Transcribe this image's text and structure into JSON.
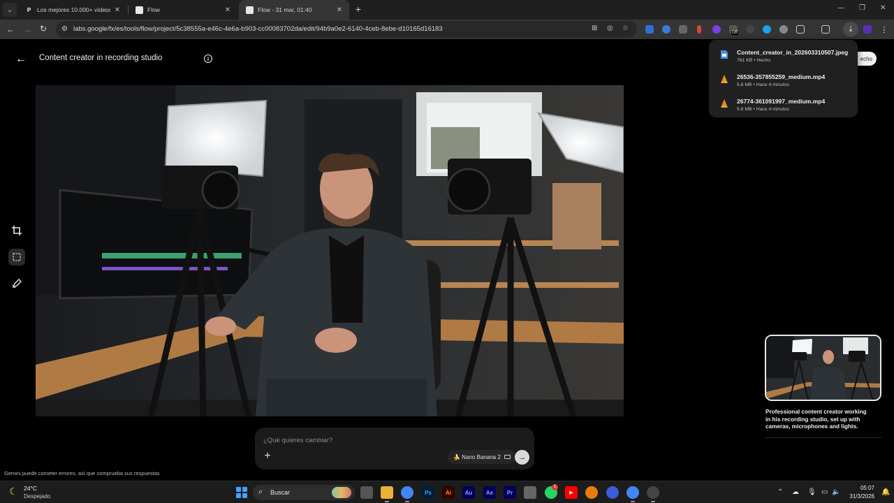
{
  "browser": {
    "tabs": [
      {
        "title": "Los mejores 10.000+ vídeos de",
        "favicon": "pexels-icon",
        "active": false
      },
      {
        "title": "Flow",
        "favicon": "page-icon",
        "active": false
      },
      {
        "title": "Flow - 31 mar, 01:40",
        "favicon": "page-icon",
        "active": true
      }
    ],
    "url": "labs.google/fx/es/tools/flow/project/5c38555a-e46c-4e6a-b903-cc00083702da/edit/94b9a0e2-6140-4ceb-8ebe-d10165d16183",
    "ext_badge": "Off"
  },
  "downloads": {
    "items": [
      {
        "name": "Content_creator_in_202603310507.jpeg",
        "meta": "761 KB • Hecho",
        "type": "image"
      },
      {
        "name": "26536-357855259_medium.mp4",
        "meta": "5,6 MB • Hace 4 minutos",
        "type": "video"
      },
      {
        "name": "26774-361091997_medium.mp4",
        "meta": "5,6 MB • Hace 4 minutos",
        "type": "video"
      }
    ],
    "behind_chip": "echo"
  },
  "app": {
    "title": "Content creator in recording studio",
    "thumbnail_caption": "Professional content creator working in his recording studio, set up with cameras, microphones and lights.",
    "prompt": {
      "placeholder": "¿Qué quieres cambiar?",
      "model_label": "🍌 Nano Banana 2"
    },
    "disclaimer": "Gemini puede cometer errores, así que comprueba sus respuestas"
  },
  "taskbar": {
    "weather_temp": "24°C",
    "weather_desc": "Despejado",
    "search_label": "Buscar",
    "apps": [
      {
        "name": "task-view",
        "label": "",
        "color": "#555555"
      },
      {
        "name": "file-explorer",
        "label": "",
        "color": "#e8b335"
      },
      {
        "name": "chrome",
        "label": "",
        "color": "#4285f4"
      },
      {
        "name": "photoshop",
        "label": "Ps",
        "color": "#001e36"
      },
      {
        "name": "illustrator",
        "label": "Ai",
        "color": "#330000"
      },
      {
        "name": "audition",
        "label": "Au",
        "color": "#00005b"
      },
      {
        "name": "after-effects",
        "label": "Ae",
        "color": "#00005b"
      },
      {
        "name": "premiere",
        "label": "Pr",
        "color": "#00005b"
      },
      {
        "name": "app-generic",
        "label": "",
        "color": "#666666"
      },
      {
        "name": "whatsapp",
        "label": "",
        "color": "#25d366"
      },
      {
        "name": "youtube",
        "label": "▶",
        "color": "#ff0000"
      },
      {
        "name": "blender",
        "label": "",
        "color": "#e87d0d"
      },
      {
        "name": "app-blue",
        "label": "",
        "color": "#3b5bdb"
      },
      {
        "name": "chrome-2",
        "label": "",
        "color": "#4285f4"
      },
      {
        "name": "app-record",
        "label": "",
        "color": "#444444"
      }
    ],
    "whatsapp_badge": "1",
    "time": "05:07",
    "date": "31/3/2026"
  }
}
